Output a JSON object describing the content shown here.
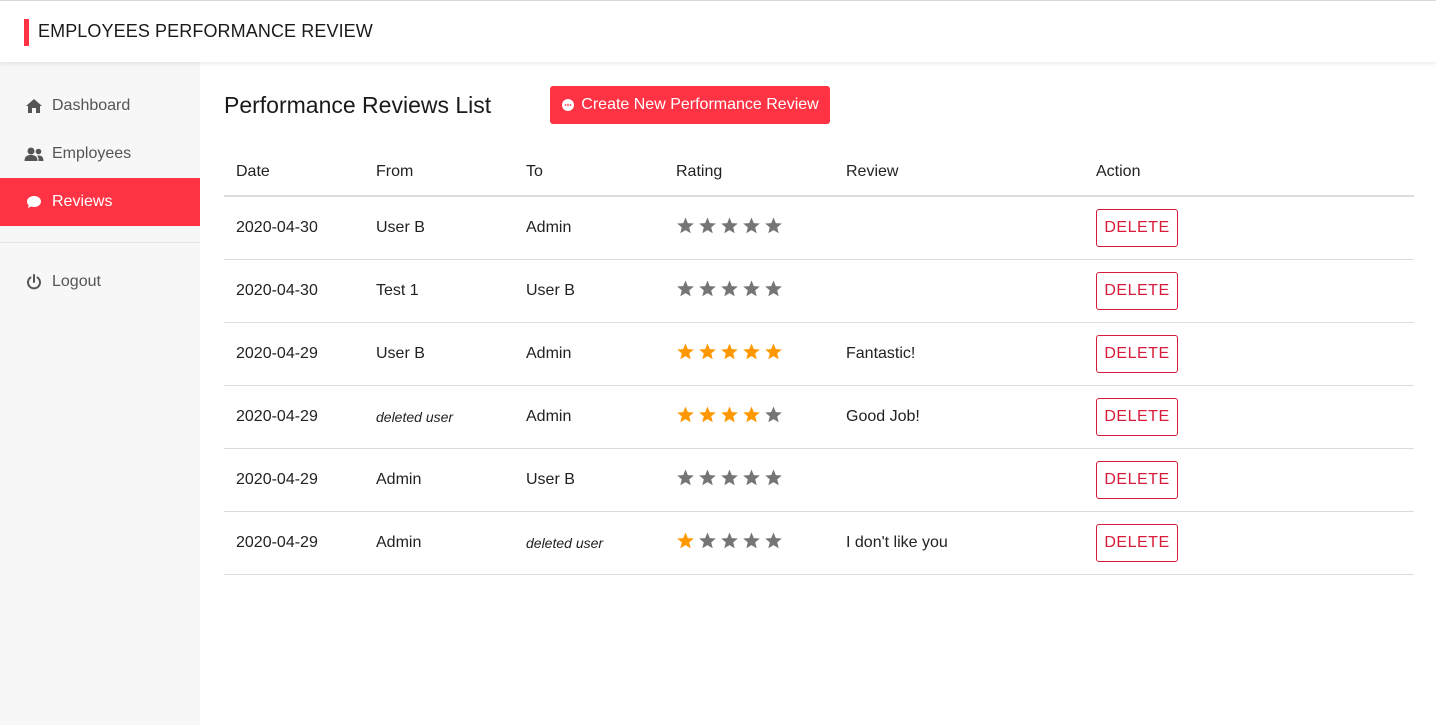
{
  "header": {
    "title": "EMPLOYEES PERFORMANCE REVIEW",
    "accent": "#ff3344"
  },
  "sidebar": {
    "items": [
      {
        "label": "Dashboard",
        "icon": "home-icon",
        "active": false
      },
      {
        "label": "Employees",
        "icon": "users-icon",
        "active": false
      },
      {
        "label": "Reviews",
        "icon": "chat-bubble-icon",
        "active": true
      },
      {
        "label": "Logout",
        "icon": "power-icon",
        "active": false
      }
    ]
  },
  "main": {
    "title": "Performance Reviews List",
    "create_button": {
      "label": "Create New Performance Review",
      "icon": "chat-bubble-icon"
    },
    "table": {
      "headers": [
        "Date",
        "From",
        "To",
        "Rating",
        "Review",
        "Action"
      ],
      "star_max": 5,
      "star_colors": {
        "filled": "#ff9800",
        "empty": "#757575"
      },
      "rows": [
        {
          "date": "2020-04-30",
          "from": "User B",
          "to": "Admin",
          "rating": 0,
          "review": "",
          "action": "DELETE"
        },
        {
          "date": "2020-04-30",
          "from": "Test 1",
          "to": "User B",
          "rating": 0,
          "review": "",
          "action": "DELETE"
        },
        {
          "date": "2020-04-29",
          "from": "User B",
          "to": "Admin",
          "rating": 5,
          "review": "Fantastic!",
          "action": "DELETE"
        },
        {
          "date": "2020-04-29",
          "from": "deleted user",
          "to": "Admin",
          "rating": 4,
          "review": "Good Job!",
          "action": "DELETE"
        },
        {
          "date": "2020-04-29",
          "from": "Admin",
          "to": "User B",
          "rating": 0,
          "review": "",
          "action": "DELETE"
        },
        {
          "date": "2020-04-29",
          "from": "Admin",
          "to": "deleted user",
          "rating": 1,
          "review": "I don't like you",
          "action": "DELETE"
        }
      ]
    }
  }
}
